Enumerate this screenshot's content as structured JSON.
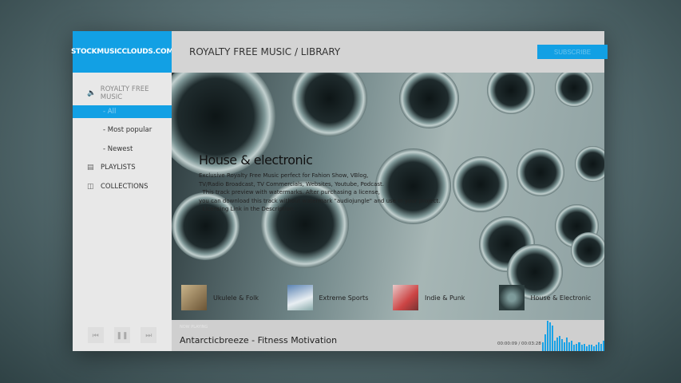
{
  "logo": "STOCKMUSICCLOUDS.COM",
  "header": {
    "title": "ROYALTY FREE MUSIC / LIBRARY",
    "subscribe": "SUBSCRIBE"
  },
  "sidebar": {
    "section": "ROYALTY FREE MUSIC",
    "items": [
      {
        "label": "- All"
      },
      {
        "label": "- Most popular"
      },
      {
        "label": "- Newest"
      }
    ],
    "playlists": "PLAYLISTS",
    "collections": "COLLECTIONS"
  },
  "hero": {
    "title": "House & electronic",
    "description": "Exclusive Royalty Free Music perfect for Fahion Show, VBlog,\nTV/Radio Broadcast, TV Commercials, Websites, Youtube, Podcast.\n  This track preview with watermarks. After purchasing a license,\nyou can download this track without watermark \"audiojungle\" and use in your project.\n  Licensing Link in the Description."
  },
  "categories": [
    {
      "label": "Ukulele & Folk"
    },
    {
      "label": "Extreme Sports"
    },
    {
      "label": "Indie & Punk"
    },
    {
      "label": "House & Electronic"
    }
  ],
  "player": {
    "now_playing": "NOW PLAYING",
    "track": "Antarcticbreeze - Fitness Motivation",
    "time": "00:00:09 / 00:03:28"
  },
  "visualizer_levels": [
    0.3,
    0.55,
    1,
    0.95,
    0.85,
    0.35,
    0.45,
    0.5,
    0.4,
    0.3,
    0.45,
    0.3,
    0.35,
    0.2,
    0.25,
    0.3,
    0.2,
    0.25,
    0.15,
    0.2,
    0.22,
    0.15,
    0.2,
    0.3,
    0.25,
    0.35
  ]
}
